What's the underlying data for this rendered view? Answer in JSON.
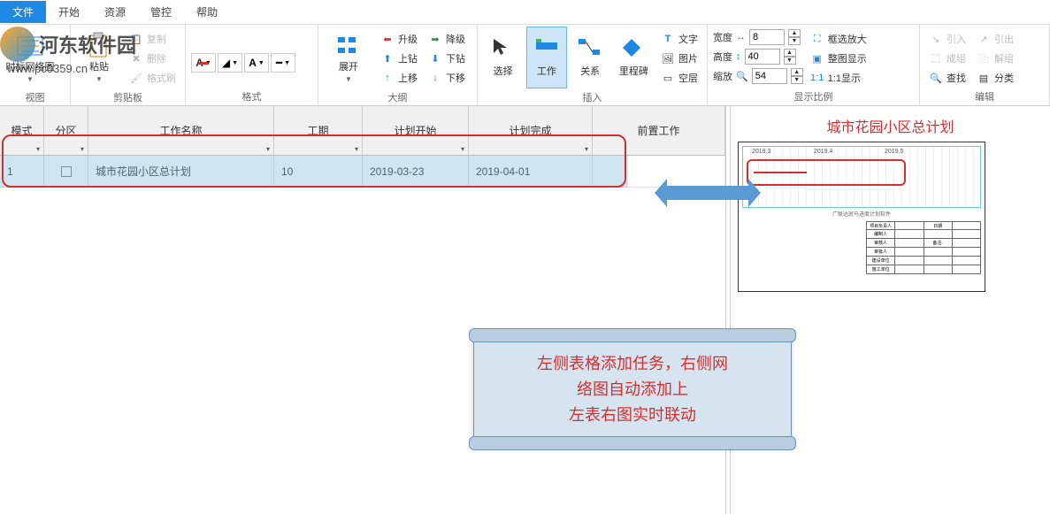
{
  "watermark": {
    "name": "河东软件园",
    "url": "www.pc0359.cn"
  },
  "menu": {
    "file": "文件",
    "start": "开始",
    "resource": "资源",
    "control": "管控",
    "help": "帮助"
  },
  "ribbon": {
    "view": {
      "label": "视图",
      "main_btn": "时标网络图"
    },
    "clipboard": {
      "label": "剪贴板",
      "paste": "粘贴",
      "copy": "复制",
      "delete": "删除",
      "format_painter": "格式刷"
    },
    "format": {
      "label": "格式"
    },
    "outline": {
      "label": "大纲",
      "expand": "展开",
      "promote": "升级",
      "demote": "降级",
      "drill_up": "上钻",
      "drill_down": "下钻",
      "move_up": "上移",
      "move_down": "下移"
    },
    "insert": {
      "label": "插入",
      "select": "选择",
      "work": "工作",
      "relation": "关系",
      "milestone": "里程碑",
      "text": "文字",
      "image": "图片",
      "layer": "空层"
    },
    "zoom": {
      "label": "显示比例",
      "width": "宽度",
      "height": "高度",
      "scale": "缩放",
      "width_val": "8",
      "height_val": "40",
      "scale_val": "54",
      "box_zoom": "框选放大",
      "full": "整图显示",
      "one_one": "1:1显示"
    },
    "edit": {
      "label": "编辑",
      "import": "引入",
      "export": "引出",
      "group": "成组",
      "ungroup": "解组",
      "find": "查找",
      "category": "分类"
    }
  },
  "grid": {
    "headers": {
      "mode": "模式",
      "zone": "分区",
      "name": "工作名称",
      "duration": "工期",
      "plan_start": "计划开始",
      "plan_end": "计划完成",
      "predecessor": "前置工作"
    },
    "row": {
      "idx": "1",
      "name": "城市花园小区总计划",
      "duration": "10",
      "start": "2019-03-23",
      "end": "2019-04-01"
    }
  },
  "right": {
    "title": "城市花园小区总计划"
  },
  "callout": {
    "line1": "左侧表格添加任务，右侧网",
    "line2": "络图自动添加上",
    "line3": "左表右图实时联动"
  }
}
